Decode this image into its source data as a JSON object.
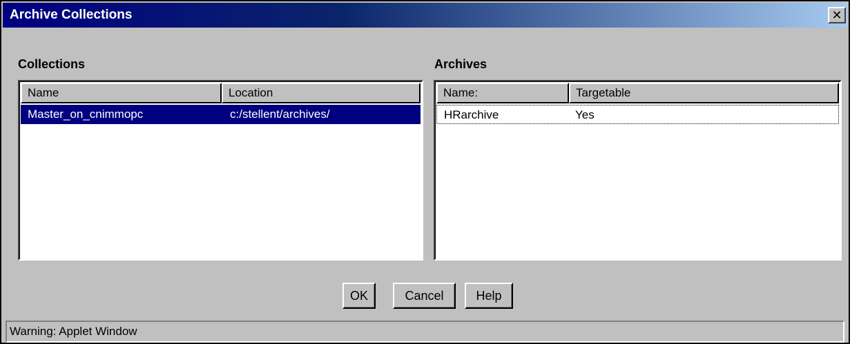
{
  "window": {
    "title": "Archive Collections",
    "close_glyph": "✕"
  },
  "collections": {
    "label": "Collections",
    "columns": [
      "Name",
      "Location"
    ],
    "rows": [
      {
        "name": "Master_on_cnimmopc",
        "location": "c:/stellent/archives/",
        "selected": true
      }
    ]
  },
  "archives": {
    "label": "Archives",
    "columns": [
      "Name:",
      "Targetable"
    ],
    "rows": [
      {
        "name": "HRarchive",
        "targetable": "Yes",
        "focused": true
      }
    ]
  },
  "buttons": {
    "ok": "OK",
    "cancel": "Cancel",
    "help": "Help"
  },
  "status": {
    "text": "Warning: Applet Window"
  },
  "colors": {
    "titlebar_start": "#000080",
    "titlebar_end": "#a6caf0",
    "selection": "#000080",
    "face": "#c0c0c0"
  }
}
